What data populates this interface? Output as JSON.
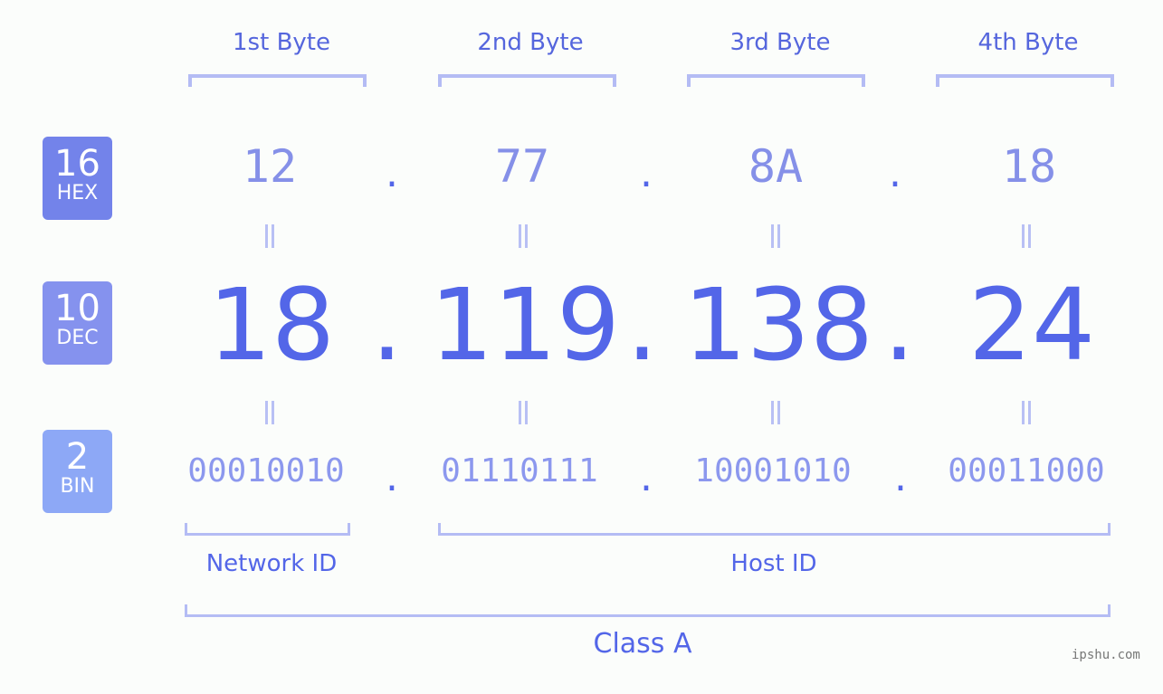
{
  "bytes": [
    {
      "label": "1st Byte",
      "hex": "12",
      "dec": "18",
      "bin": "00010010"
    },
    {
      "label": "2nd Byte",
      "hex": "77",
      "dec": "119",
      "bin": "01110111"
    },
    {
      "label": "3rd Byte",
      "hex": "8A",
      "dec": "138",
      "bin": "10001010"
    },
    {
      "label": "4th Byte",
      "hex": "18",
      "dec": "24",
      "bin": "00011000"
    }
  ],
  "separator": ".",
  "badges": {
    "hex": {
      "num": "16",
      "label": "HEX",
      "color": "#7383ea"
    },
    "dec": {
      "num": "10",
      "label": "DEC",
      "color": "#8592ee"
    },
    "bin": {
      "num": "2",
      "label": "BIN",
      "color": "#8da8f6"
    }
  },
  "sections": {
    "network": "Network ID",
    "host": "Host ID",
    "class": "Class A"
  },
  "watermark": "ipshu.com"
}
